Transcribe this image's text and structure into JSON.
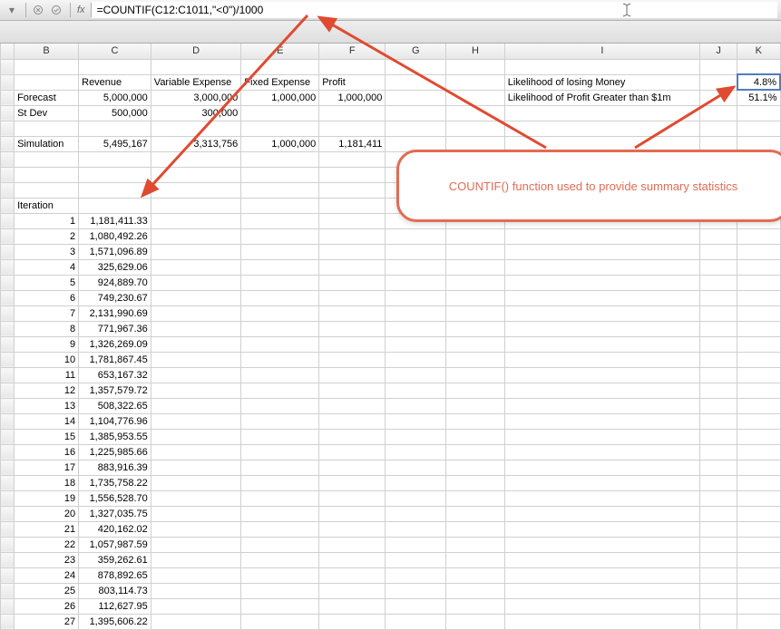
{
  "toolbar": {
    "fx_label": "fx",
    "formula": "=COUNTIF(C12:C1011,\"<0\")/1000"
  },
  "columns": [
    "B",
    "C",
    "D",
    "E",
    "F",
    "G",
    "H",
    "I",
    "J",
    "K"
  ],
  "labels": {
    "revenue": "Revenue",
    "variable_expense": "Variable Expense",
    "fixed_expense": "Fixed Expense",
    "profit": "Profit",
    "forecast": "Forecast",
    "st_dev": "St Dev",
    "simulation": "Simulation",
    "iteration": "Iteration",
    "like_lose": "Likelihood of losing Money",
    "like_gt1m": "Likelihood of Profit Greater than $1m"
  },
  "forecast": {
    "revenue": "5,000,000",
    "variable_expense": "3,000,000",
    "fixed_expense": "1,000,000",
    "profit": "1,000,000"
  },
  "st_dev": {
    "revenue": "500,000",
    "variable_expense": "300,000"
  },
  "simulation": {
    "revenue": "5,495,167",
    "variable_expense": "3,313,756",
    "fixed_expense": "1,000,000",
    "profit": "1,181,411"
  },
  "stats": {
    "like_lose_val": "4.8%",
    "like_gt1m_val": "51.1%"
  },
  "iterations": [
    {
      "n": "1",
      "v": "1,181,411.33"
    },
    {
      "n": "2",
      "v": "1,080,492.26"
    },
    {
      "n": "3",
      "v": "1,571,096.89"
    },
    {
      "n": "4",
      "v": "325,629.06"
    },
    {
      "n": "5",
      "v": "924,889.70"
    },
    {
      "n": "6",
      "v": "749,230.67"
    },
    {
      "n": "7",
      "v": "2,131,990.69"
    },
    {
      "n": "8",
      "v": "771,967.36"
    },
    {
      "n": "9",
      "v": "1,326,269.09"
    },
    {
      "n": "10",
      "v": "1,781,867.45"
    },
    {
      "n": "11",
      "v": "653,167.32"
    },
    {
      "n": "12",
      "v": "1,357,579.72"
    },
    {
      "n": "13",
      "v": "508,322.65"
    },
    {
      "n": "14",
      "v": "1,104,776.96"
    },
    {
      "n": "15",
      "v": "1,385,953.55"
    },
    {
      "n": "16",
      "v": "1,225,985.66"
    },
    {
      "n": "17",
      "v": "883,916.39"
    },
    {
      "n": "18",
      "v": "1,735,758.22"
    },
    {
      "n": "19",
      "v": "1,556,528.70"
    },
    {
      "n": "20",
      "v": "1,327,035.75"
    },
    {
      "n": "21",
      "v": "420,162.02"
    },
    {
      "n": "22",
      "v": "1,057,987.59"
    },
    {
      "n": "23",
      "v": "359,262.61"
    },
    {
      "n": "24",
      "v": "878,892.65"
    },
    {
      "n": "25",
      "v": "803,114.73"
    },
    {
      "n": "26",
      "v": "112,627.95"
    },
    {
      "n": "27",
      "v": "1,395,606.22"
    }
  ],
  "callout": "COUNTIF() function used to provide summary statistics"
}
